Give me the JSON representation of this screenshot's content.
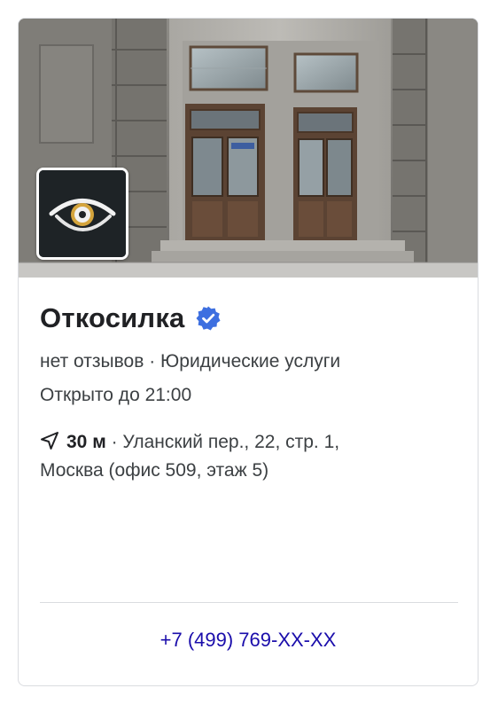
{
  "place": {
    "name": "Откосилка",
    "reviews": "нет отзывов",
    "separator": "·",
    "category": "Юридические услуги",
    "hours": "Открыто до 21:00",
    "distance": "30 м",
    "address_line1": "Уланский пер., 22, стр. 1,",
    "address_line2": "Москва (офис 509, этаж 5)",
    "phone": "+7 (499) 769-XX-XX"
  },
  "icons": {
    "verified": "verified-badge-icon",
    "navigation": "navigation-arrow-icon",
    "logo": "eye-logo"
  },
  "colors": {
    "verified_blue": "#3d6fe0",
    "phone_link": "#1a0dab",
    "divider": "#dadce0",
    "logo_bg": "#1e2326"
  }
}
